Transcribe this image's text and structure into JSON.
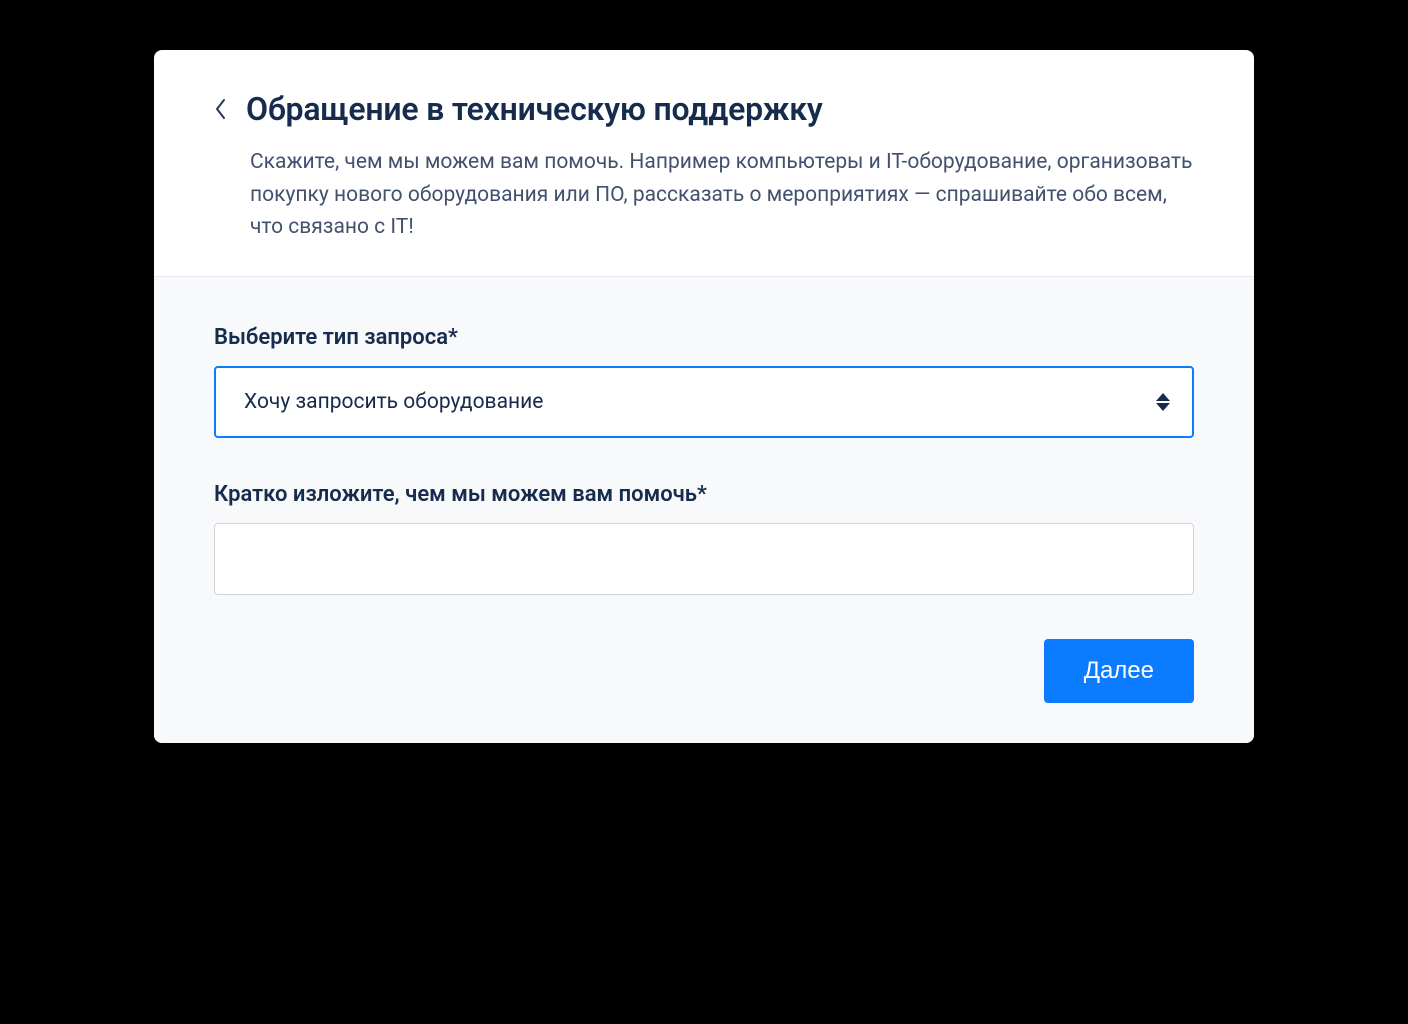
{
  "header": {
    "title": "Обращение в техническую поддержку",
    "subtitle": "Скажите, чем мы можем вам помочь. Например компьютеры и IT-оборудование, организовать покупку нового оборудования или ПО, рассказать о мероприятиях — спрашивайте обо всем, что связано с IT!"
  },
  "form": {
    "request_type": {
      "label": "Выберите тип запроса*",
      "selected": "Хочу запросить оборудование"
    },
    "summary": {
      "label": "Кратко изложите, чем мы можем вам помочь*",
      "value": ""
    },
    "next_label": "Далее"
  }
}
